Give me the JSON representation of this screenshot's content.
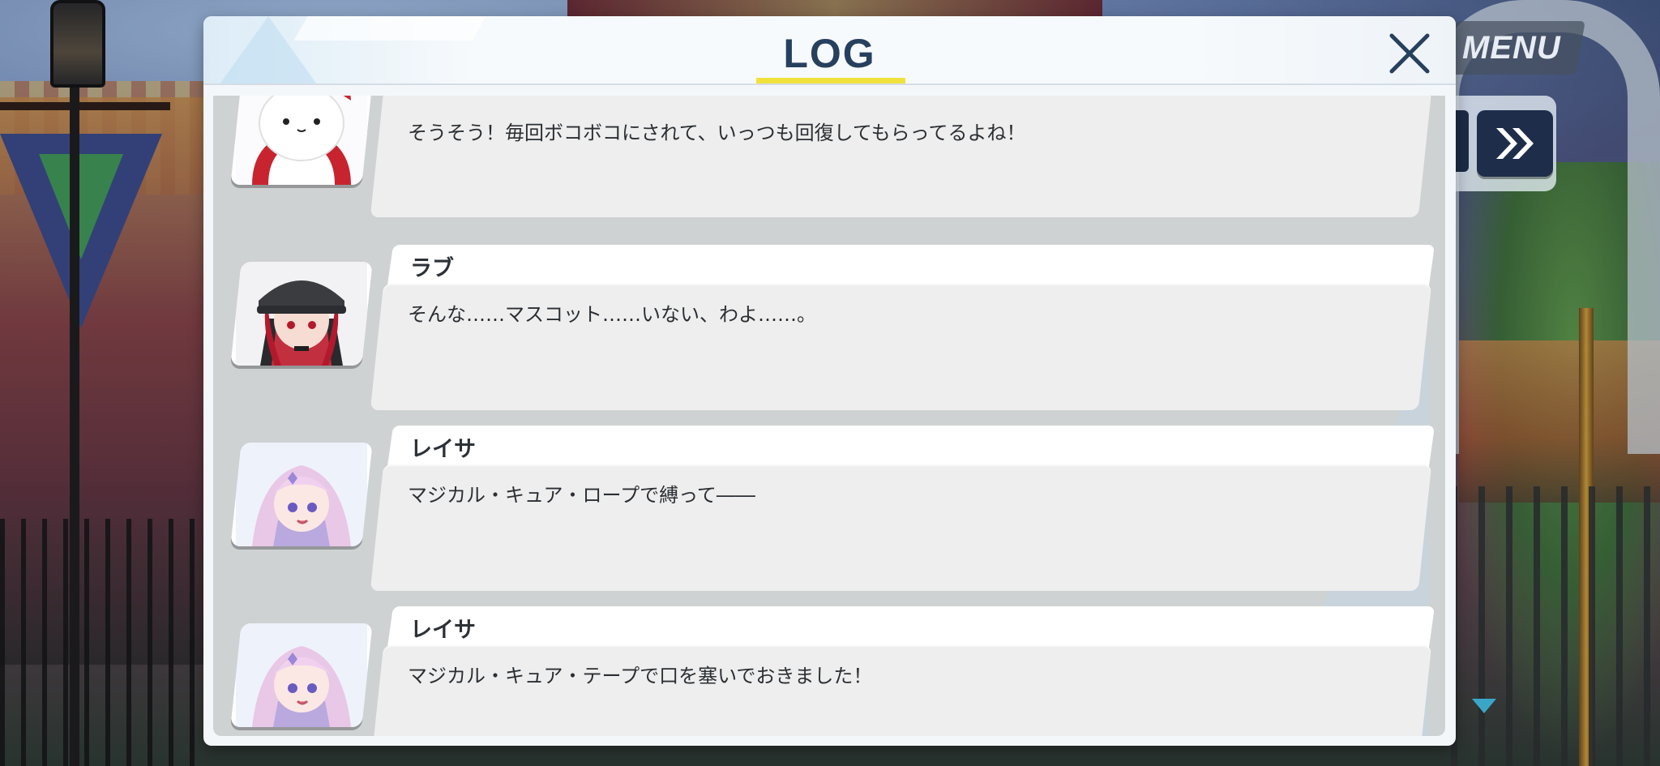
{
  "hud": {
    "menu_label": "MENU",
    "skip_icon": "fast-forward-icon",
    "scroll_indicator_icon": "triangle-down-icon",
    "accent_color": "#3aa6c7"
  },
  "log": {
    "title": "LOG",
    "title_underline_color": "#f0e23c",
    "close_icon": "close-icon",
    "entries": [
      {
        "speaker": "",
        "portrait_icon": "white-mascot-portrait",
        "text": "そうそう！毎回ボコボコにされて、いっつも回復してもらってるよね！"
      },
      {
        "speaker": "ラブ",
        "portrait_icon": "red-hair-helmet-girl-portrait",
        "text": "そんな……マスコット……いない、わよ……。"
      },
      {
        "speaker": "レイサ",
        "portrait_icon": "pink-hair-girl-portrait",
        "text": "マジカル・キュア・ロープで縛って――"
      },
      {
        "speaker": "レイサ",
        "portrait_icon": "pink-hair-girl-portrait",
        "text": "マジカル・キュア・テープで口を塞いでおきました！"
      }
    ]
  }
}
